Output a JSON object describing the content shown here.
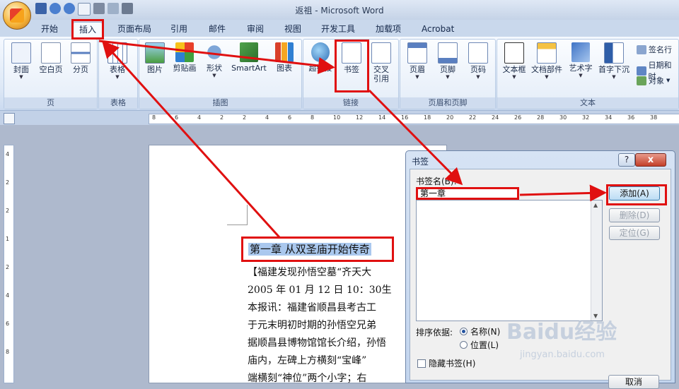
{
  "window": {
    "title": "返祖 - Microsoft Word"
  },
  "ribbon_tabs": [
    "开始",
    "插入",
    "页面布局",
    "引用",
    "邮件",
    "审阅",
    "视图",
    "开发工具",
    "加载项",
    "Acrobat"
  ],
  "groups": {
    "pages": {
      "label": "页",
      "buttons": [
        "封面",
        "空白页",
        "分页"
      ]
    },
    "tables": {
      "label": "表格",
      "buttons": [
        "表格"
      ]
    },
    "illustrations": {
      "label": "插图",
      "buttons": [
        "图片",
        "剪贴画",
        "形状",
        "SmartArt",
        "图表"
      ]
    },
    "links": {
      "label": "链接",
      "buttons": [
        "超链接",
        "书签",
        "交叉\n引用"
      ]
    },
    "header_footer": {
      "label": "页眉和页脚",
      "buttons": [
        "页眉",
        "页脚",
        "页码"
      ]
    },
    "text": {
      "label": "文本",
      "buttons": [
        "文本框",
        "文档部件",
        "艺术字",
        "首字下沉"
      ],
      "small": [
        "签名行",
        "日期和时",
        "对象"
      ]
    }
  },
  "ruler": {
    "h_ticks": [
      "8",
      "6",
      "4",
      "2",
      "2",
      "4",
      "6",
      "8",
      "10",
      "12",
      "14",
      "16",
      "18",
      "20",
      "22",
      "24",
      "26",
      "28",
      "30",
      "32",
      "34",
      "36",
      "38"
    ],
    "v_ticks": [
      "4",
      "2",
      "2",
      "1",
      "2",
      "4",
      "6",
      "8"
    ]
  },
  "document": {
    "heading": "第一章 从双圣庙开始传奇",
    "lines": [
      "【福建发现孙悟空墓“齐天大",
      "2005 年 01 月 12 日 10：30生",
      "本报讯：福建省顺昌县考古工",
      "于元末明初时期的孙悟空兄弟",
      "据顺昌县博物馆馆长介绍，孙悟",
      "庙内，左碑上方横刻“宝峰”",
      "端横刻“神位”两个小字；右"
    ]
  },
  "dialog": {
    "title": "书签",
    "help": "?",
    "close": "x",
    "name_label": "书签名(B):",
    "name_value": "第一章",
    "add_button": "添加(A)",
    "delete_button": "删除(D)",
    "goto_button": "定位(G)",
    "sort_label": "排序依据:",
    "sort_options": [
      "名称(N)",
      "位置(L)"
    ],
    "sort_selected": "名称(N)",
    "hidden_checkbox": "隐藏书签(H)",
    "cancel_button": "取消"
  },
  "watermark": {
    "brand": "Baidu经验",
    "url": "jingyan.baidu.com"
  },
  "colors": {
    "annotation": "#e01010",
    "selection": "#aac8ee"
  }
}
